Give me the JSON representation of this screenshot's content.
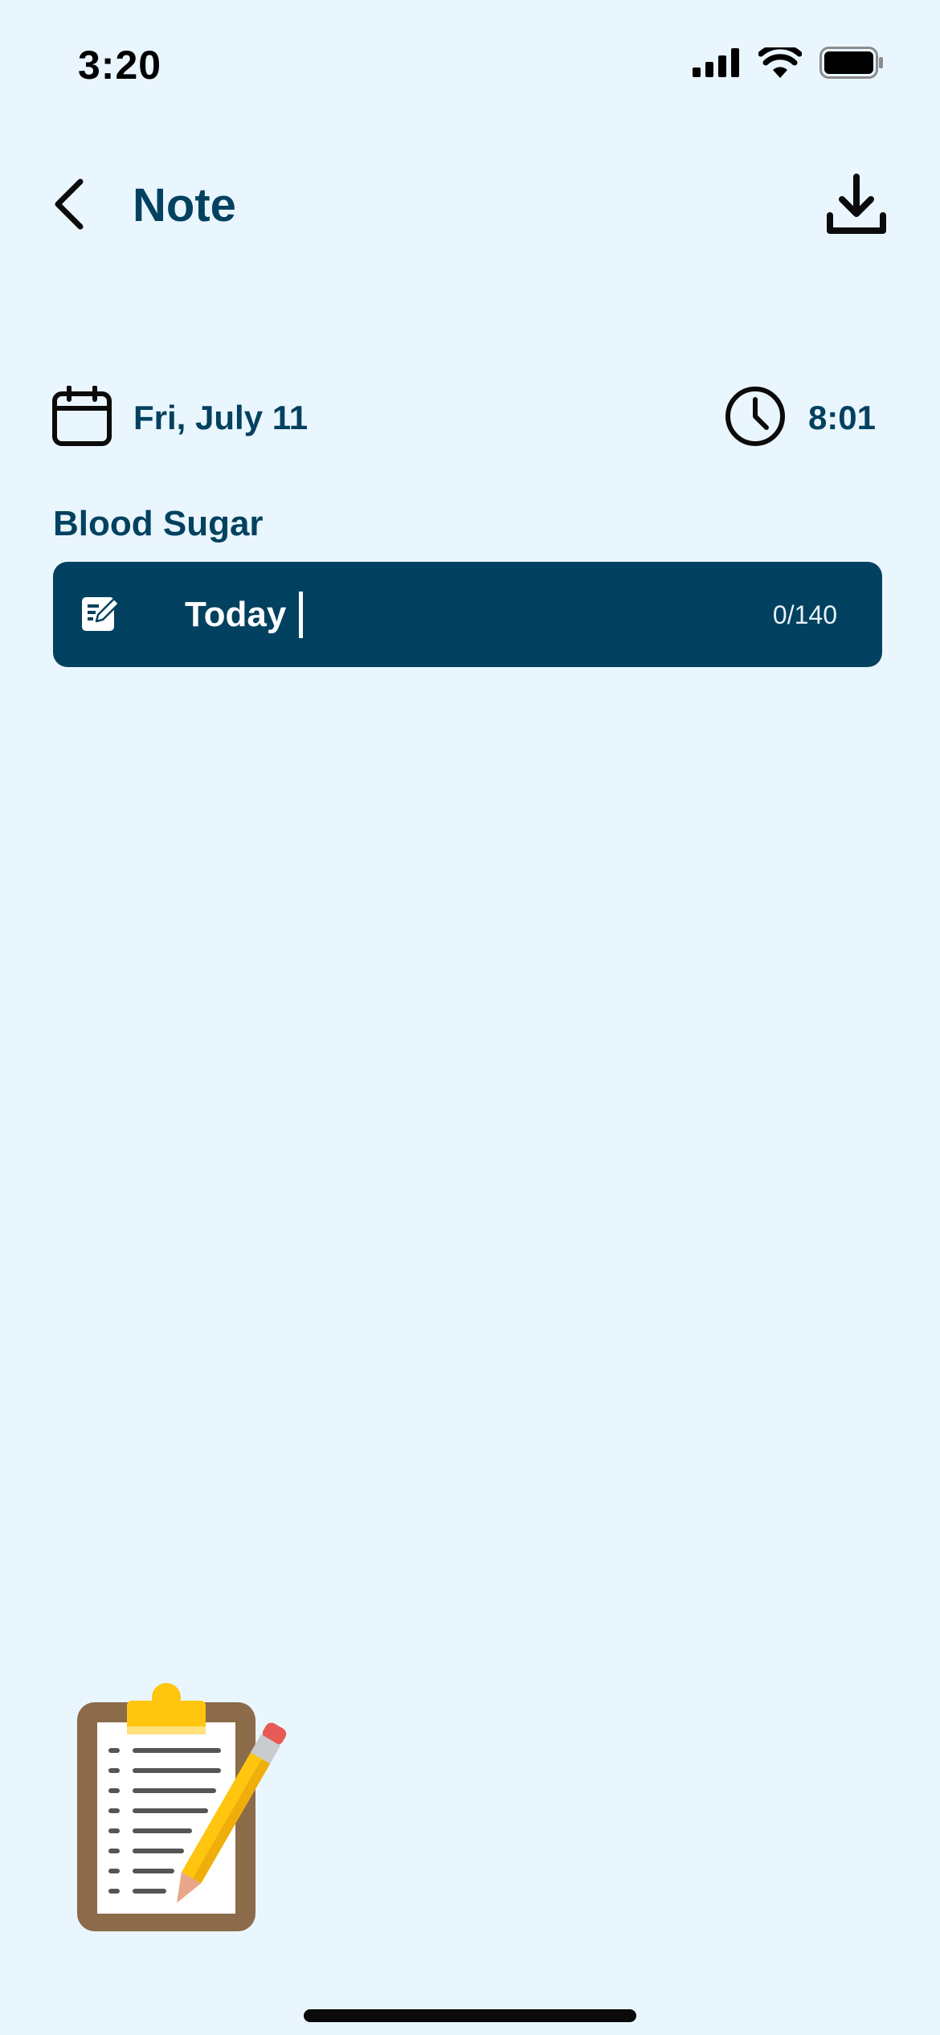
{
  "status_bar": {
    "time": "3:20",
    "icons": [
      "signal-icon",
      "wifi-icon",
      "battery-icon"
    ]
  },
  "header": {
    "title": "Note",
    "back_icon": "chevron-left-icon",
    "download_icon": "download-icon"
  },
  "datetime": {
    "date": "Fri, July 11",
    "time": "8:01",
    "date_icon": "calendar-icon",
    "time_icon": "clock-icon"
  },
  "note": {
    "label": "Blood Sugar",
    "value": "Today",
    "counter": "0/140",
    "icon": "edit-note-icon"
  },
  "colors": {
    "background": "#EAF6FE",
    "primary": "#02415F",
    "field_text": "#FFFFFF"
  }
}
